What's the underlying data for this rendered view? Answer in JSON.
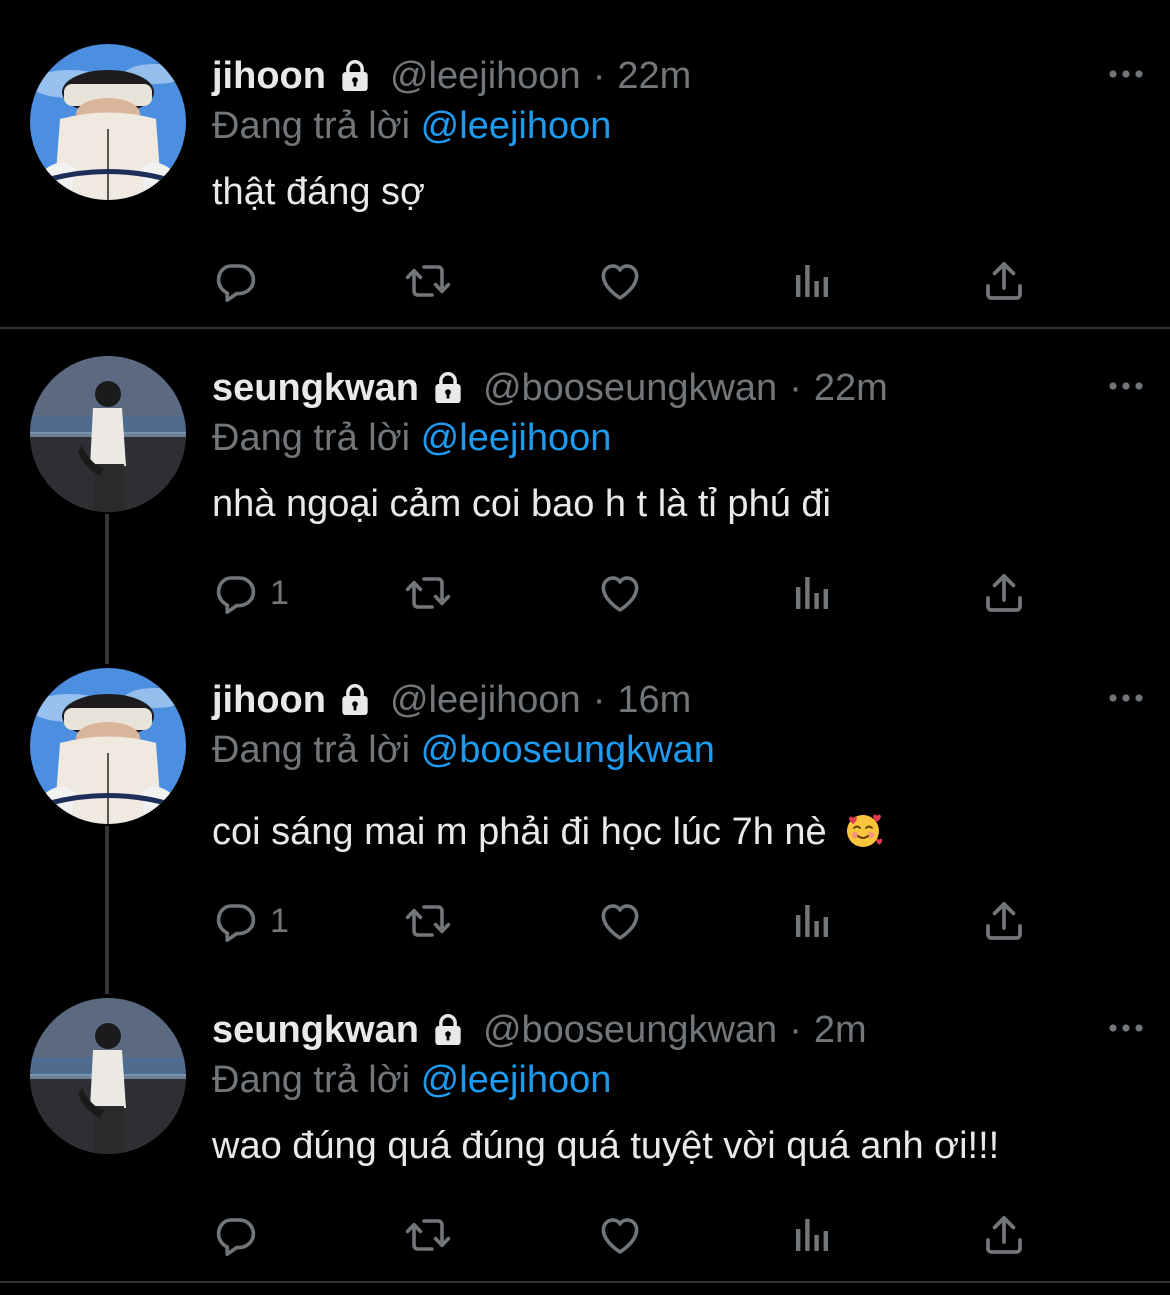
{
  "colors": {
    "background": "#000000",
    "text": "#e7e9ea",
    "secondary": "#71767b",
    "mention": "#1d9bf0",
    "divider": "#2f3336"
  },
  "reply_prefix": "Đang trả lời",
  "tweets": [
    {
      "name": "jihoon",
      "handle": "@leejihoon",
      "time": "22m",
      "reply_to": "@leejihoon",
      "text": "thật đáng sợ",
      "reply_count": "",
      "avatar": "jihoon-avatar"
    },
    {
      "name": "seungkwan",
      "handle": "@booseungkwan",
      "time": "22m",
      "reply_to": "@leejihoon",
      "text": "nhà ngoại cảm coi bao h t là tỉ phú đi",
      "reply_count": "1",
      "avatar": "seungkwan-avatar"
    },
    {
      "name": "jihoon",
      "handle": "@leejihoon",
      "time": "16m",
      "reply_to": "@booseungkwan",
      "text": "coi sáng mai m phải đi học lúc 7h nè",
      "emoji": "smiling-face-with-hearts-emoji",
      "reply_count": "1",
      "avatar": "jihoon-avatar"
    },
    {
      "name": "seungkwan",
      "handle": "@booseungkwan",
      "time": "2m",
      "reply_to": "@leejihoon",
      "text": "wao đúng quá đúng quá tuyệt vời quá anh ơi!!!",
      "reply_count": "",
      "avatar": "seungkwan-avatar"
    }
  ],
  "icons": [
    "lock-icon",
    "more-icon",
    "reply-icon",
    "retweet-icon",
    "like-icon",
    "views-icon",
    "share-icon"
  ]
}
